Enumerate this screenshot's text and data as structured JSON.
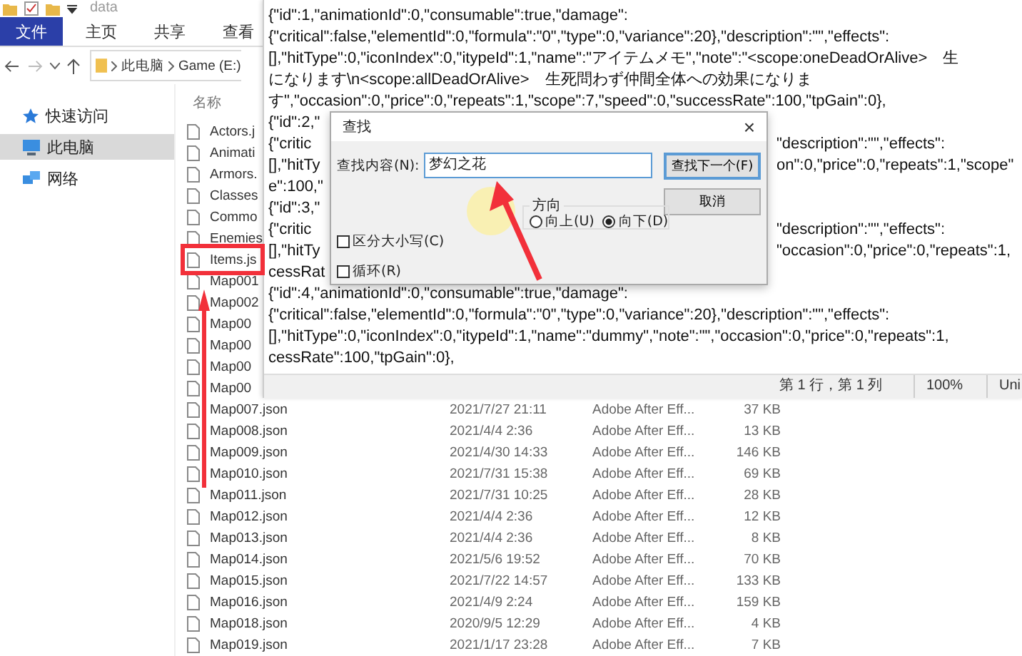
{
  "explorer": {
    "title": "data",
    "ribbon_tabs": [
      {
        "label": "文件",
        "selected": true
      },
      {
        "label": "主页",
        "selected": false
      },
      {
        "label": "共享",
        "selected": false
      },
      {
        "label": "查看",
        "selected": false
      }
    ],
    "breadcrumb": [
      "此电脑",
      "Game (E:)"
    ],
    "nav_items": [
      {
        "label": "快速访问",
        "kind": "star",
        "selected": false
      },
      {
        "label": "此电脑",
        "kind": "computer",
        "selected": true
      },
      {
        "label": "网络",
        "kind": "network",
        "selected": false
      }
    ],
    "column_header": "名称",
    "files": [
      {
        "name": "Actors.j"
      },
      {
        "name": "Animati"
      },
      {
        "name": "Armors."
      },
      {
        "name": "Classes"
      },
      {
        "name": "Commo"
      },
      {
        "name": "Enemies"
      },
      {
        "name": "Items.js"
      },
      {
        "name": "Map001"
      },
      {
        "name": "Map002"
      },
      {
        "name": "Map00"
      },
      {
        "name": "Map00"
      },
      {
        "name": "Map00"
      },
      {
        "name": "Map00"
      },
      {
        "name": "Map007.json",
        "date": "2021/7/27 21:11",
        "type": "Adobe After Eff...",
        "size": "37 KB"
      },
      {
        "name": "Map008.json",
        "date": "2021/4/4 2:36",
        "type": "Adobe After Eff...",
        "size": "13 KB"
      },
      {
        "name": "Map009.json",
        "date": "2021/4/30 14:33",
        "type": "Adobe After Eff...",
        "size": "146 KB"
      },
      {
        "name": "Map010.json",
        "date": "2021/7/31 15:38",
        "type": "Adobe After Eff...",
        "size": "69 KB"
      },
      {
        "name": "Map011.json",
        "date": "2021/7/31 10:25",
        "type": "Adobe After Eff...",
        "size": "28 KB"
      },
      {
        "name": "Map012.json",
        "date": "2021/4/4 2:36",
        "type": "Adobe After Eff...",
        "size": "12 KB"
      },
      {
        "name": "Map013.json",
        "date": "2021/4/4 2:36",
        "type": "Adobe After Eff...",
        "size": "8 KB"
      },
      {
        "name": "Map014.json",
        "date": "2021/5/6 19:52",
        "type": "Adobe After Eff...",
        "size": "70 KB"
      },
      {
        "name": "Map015.json",
        "date": "2021/7/22 14:57",
        "type": "Adobe After Eff...",
        "size": "133 KB"
      },
      {
        "name": "Map016.json",
        "date": "2021/4/9 2:24",
        "type": "Adobe After Eff...",
        "size": "159 KB"
      },
      {
        "name": "Map018.json",
        "date": "2020/9/5 12:29",
        "type": "Adobe After Eff...",
        "size": "4 KB"
      },
      {
        "name": "Map019.json",
        "date": "2021/1/17 23:28",
        "type": "Adobe After Eff...",
        "size": "7 KB"
      }
    ]
  },
  "notepad": {
    "lines": [
      {
        "text": "{\"id\":1,\"animationId\":0,\"consumable\":true,\"damage\":"
      },
      {
        "text": "{\"critical\":false,\"elementId\":0,\"formula\":\"0\",\"type\":0,\"variance\":20},\"description\":\"\",\"effects\":"
      },
      {
        "text": "[],\"hitType\":0,\"iconIndex\":0,\"itypeId\":1,\"name\":\"アイテムメモ\",\"note\":\"<scope:oneDeadOrAlive>　生"
      },
      {
        "text": "になります\\n<scope:allDeadOrAlive>　生死問わず仲間全体への効果になりま"
      },
      {
        "text": "す\",\"occasion\":0,\"price\":0,\"repeats\":1,\"scope\":7,\"speed\":0,\"successRate\":100,\"tpGain\":0},"
      },
      {
        "text": "{\"id\":2,\""
      },
      {
        "text": "{\"critic",
        "right": "\"description\":\"\",\"effects\":"
      },
      {
        "text": "[],\"hitTy",
        "right": "on\":0,\"price\":0,\"repeats\":1,\"scope\""
      },
      {
        "text": "e\":100,\""
      },
      {
        "text": "{\"id\":3,\""
      },
      {
        "text": "{\"critic",
        "right": "\"description\":\"\",\"effects\":"
      },
      {
        "text": "[],\"hitTy",
        "right": "\"occasion\":0,\"price\":0,\"repeats\":1,"
      },
      {
        "text": "cessRat"
      },
      {
        "text": "{\"id\":4,\"animationId\":0,\"consumable\":true,\"damage\":"
      },
      {
        "text": "{\"critical\":false,\"elementId\":0,\"formula\":\"0\",\"type\":0,\"variance\":20},\"description\":\"\",\"effects\":"
      },
      {
        "text": "[],\"hitType\":0,\"iconIndex\":0,\"itypeId\":1,\"name\":\"dummy\",\"note\":\"\",\"occasion\":0,\"price\":0,\"repeats\":1,"
      },
      {
        "text": "cessRate\":100,\"tpGain\":0},"
      }
    ],
    "status": {
      "position": "第 1 行，第 1 列",
      "zoom": "100%",
      "encoding": "Uni"
    }
  },
  "find_dialog": {
    "title": "查找",
    "close": "×",
    "find_label": "查找内容(N):",
    "find_value": "梦幻之花",
    "buttons": [
      {
        "label": "查找下一个(F)",
        "focused": true
      },
      {
        "label": "取消",
        "focused": false
      }
    ],
    "direction": {
      "label": "方向",
      "options": [
        {
          "label": "向上(U)",
          "selected": false
        },
        {
          "label": "向下(D)",
          "selected": true
        }
      ]
    },
    "checkboxes": [
      {
        "label": "区分大小写(C)",
        "checked": false
      },
      {
        "label": "循环(R)",
        "checked": false
      }
    ]
  }
}
